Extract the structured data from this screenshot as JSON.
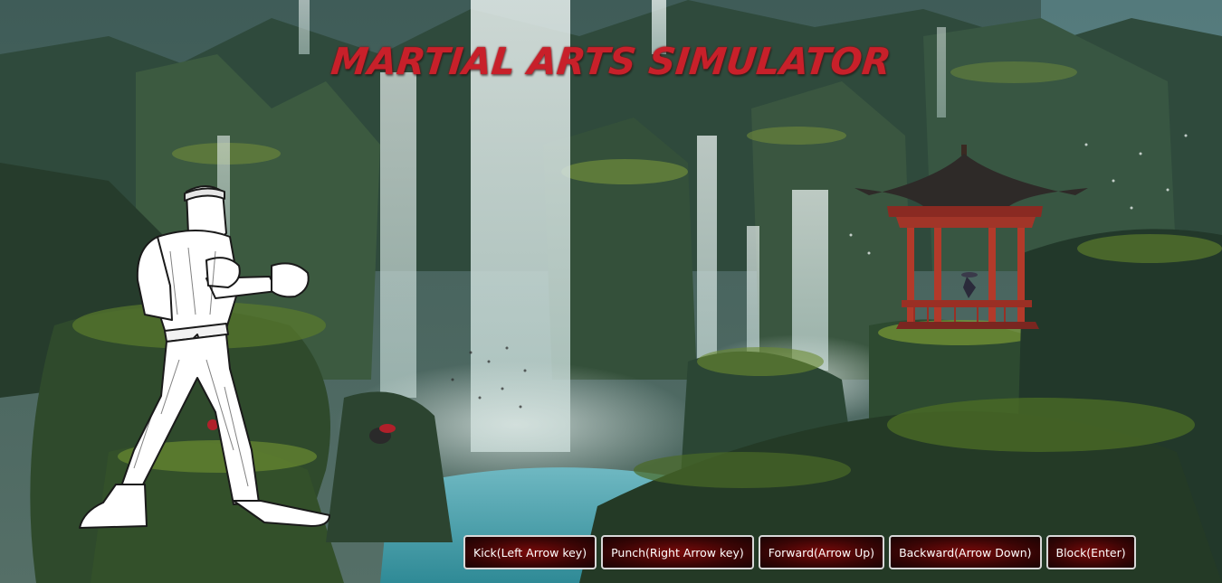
{
  "title": "MARTIAL ARTS SIMULATOR",
  "colors": {
    "title": "#c8202a",
    "button_bg": "#5a0808",
    "button_border": "#d8d8d8",
    "button_text": "#ffffff"
  },
  "controls": [
    {
      "id": "kick",
      "label": "Kick(Left Arrow key)"
    },
    {
      "id": "punch",
      "label": "Punch(Right Arrow key)"
    },
    {
      "id": "forward",
      "label": "Forward(Arrow Up)"
    },
    {
      "id": "backward",
      "label": "Backward(Arrow Down)"
    },
    {
      "id": "block",
      "label": "Block(Enter)"
    }
  ],
  "icons": {
    "fighter": "karate-fighter-icon",
    "pagoda": "pagoda-icon"
  }
}
